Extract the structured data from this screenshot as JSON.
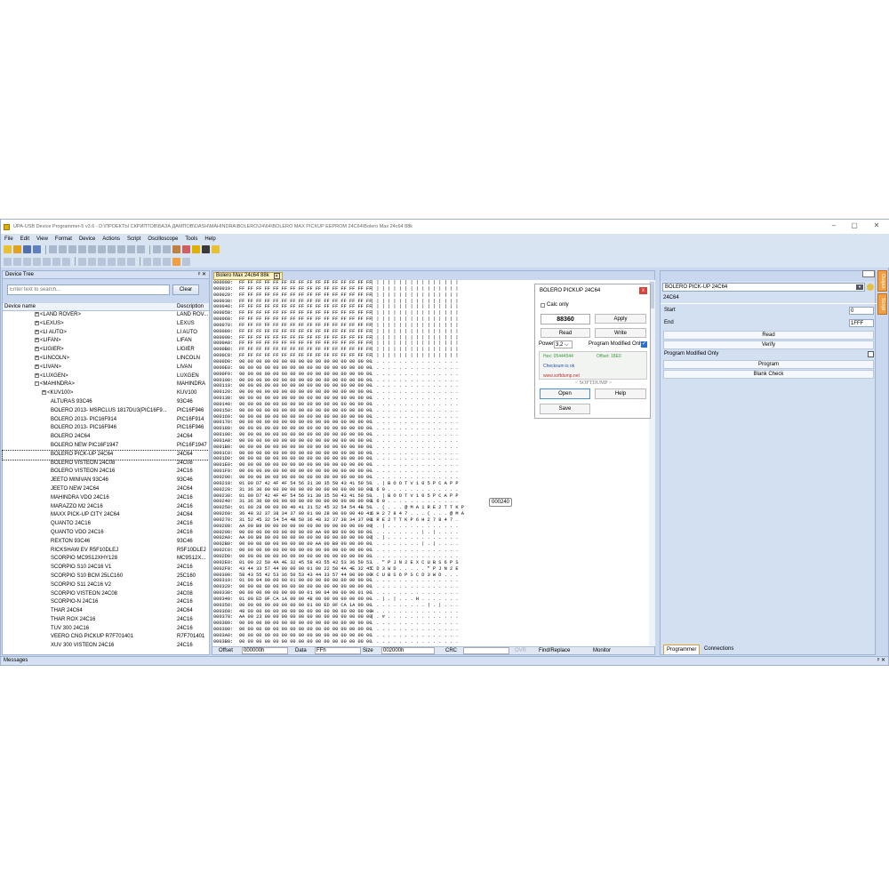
{
  "window": {
    "title": "UPA-USB Device Programmer-5 v3.6 - D:\\ПРОЕКТЫ СКРИПТОВ\\БАЗА ДАМПОВ\\DASH\\MAHINDRA\\BOLERO\\24\\64\\BOLERO MAX PICKUP EEPROM 24C64\\Bolero Max 24c64 88k",
    "minimize": "–",
    "maximize": "▢",
    "close": "✕"
  },
  "menu": [
    "File",
    "Edit",
    "View",
    "Format",
    "Device",
    "Actions",
    "Script",
    "Oscilloscope",
    "Tools",
    "Help"
  ],
  "device_tree": {
    "title": "Device Tree",
    "pin": "ᵖ ✕",
    "search_placeholder": "Enter text to search...",
    "clear": "Clear",
    "col_name": "Device name",
    "col_desc": "Description",
    "rows": [
      {
        "name": "<LAND ROVER>",
        "desc": "LAND ROV...",
        "lvl": 1,
        "exp": "+"
      },
      {
        "name": "<LEXUS>",
        "desc": "LEXUS",
        "lvl": 1,
        "exp": "+"
      },
      {
        "name": "<LI AUTO>",
        "desc": "LI AUTO",
        "lvl": 1,
        "exp": "+"
      },
      {
        "name": "<LIFAN>",
        "desc": "LIFAN",
        "lvl": 1,
        "exp": "+"
      },
      {
        "name": "<LIGIER>",
        "desc": "LIGIER",
        "lvl": 1,
        "exp": "+"
      },
      {
        "name": "<LINCOLN>",
        "desc": "LINCOLN",
        "lvl": 1,
        "exp": "+"
      },
      {
        "name": "<LIVAN>",
        "desc": "LIVAN",
        "lvl": 1,
        "exp": "+"
      },
      {
        "name": "<LUXGEN>",
        "desc": "LUXGEN",
        "lvl": 1,
        "exp": "+"
      },
      {
        "name": "<MAHINDRA>",
        "desc": "MAHINDRA",
        "lvl": 1,
        "exp": "-"
      },
      {
        "name": "<KUV100>",
        "desc": "KUV100",
        "lvl": 2,
        "exp": "+"
      },
      {
        "name": "ALTURAS 93C46",
        "desc": "93C46",
        "lvl": 3
      },
      {
        "name": "BOLERO 2013- MSRCLUS 1817DU3(PIC16F9...",
        "desc": "PIC16F946",
        "lvl": 3
      },
      {
        "name": "BOLERO 2013- PIC16F914",
        "desc": "PIC16F914",
        "lvl": 3
      },
      {
        "name": "BOLERO 2013- PIC16F946",
        "desc": "PIC16F946",
        "lvl": 3
      },
      {
        "name": "BOLERO 24C64",
        "desc": "24C64",
        "lvl": 3
      },
      {
        "name": "BOLERO NEW PIC16F1947",
        "desc": "PIC16F1947",
        "lvl": 3
      },
      {
        "name": "BOLERO PICK-UP 24C64",
        "desc": "24C64",
        "lvl": 3,
        "sel": true
      },
      {
        "name": "BOLERO VISTEON 24C08",
        "desc": "24C08",
        "lvl": 3
      },
      {
        "name": "BOLERO VISTEON 24C16",
        "desc": "24C16",
        "lvl": 3
      },
      {
        "name": "JEETO MINIVAN 93C46",
        "desc": "93C46",
        "lvl": 3
      },
      {
        "name": "JEETO NEW 24C64",
        "desc": "24C64",
        "lvl": 3
      },
      {
        "name": "MAHINDRA VDO 24C16",
        "desc": "24C16",
        "lvl": 3
      },
      {
        "name": "MARAZZO M2 24C16",
        "desc": "24C16",
        "lvl": 3
      },
      {
        "name": "MAXX PICK-UP CITY 24C64",
        "desc": "24C64",
        "lvl": 3
      },
      {
        "name": "QUANTO 24C16",
        "desc": "24C16",
        "lvl": 3
      },
      {
        "name": "QUANTO VDO 24C16",
        "desc": "24C16",
        "lvl": 3
      },
      {
        "name": "REXTON 93C46",
        "desc": "93C46",
        "lvl": 3
      },
      {
        "name": "RICKSHAW EV R5F10DLEJ",
        "desc": "R5F10DLEJ",
        "lvl": 3
      },
      {
        "name": "SCORPIO MC9S12XHY128",
        "desc": "MC9S12X...",
        "lvl": 3
      },
      {
        "name": "SCORPIO S10 24C16 V1",
        "desc": "24C16",
        "lvl": 3
      },
      {
        "name": "SCORPIO S10 BCM 25LC160",
        "desc": "25C160",
        "lvl": 3
      },
      {
        "name": "SCORPIO S11 24C16 V2",
        "desc": "24C16",
        "lvl": 3
      },
      {
        "name": "SCORPIO VISTEON 24C08",
        "desc": "24C08",
        "lvl": 3
      },
      {
        "name": "SCORPIO-N 24C16",
        "desc": "24C16",
        "lvl": 3
      },
      {
        "name": "THAR 24C64",
        "desc": "24C64",
        "lvl": 3
      },
      {
        "name": "THAR ROX 24C16",
        "desc": "24C16",
        "lvl": 3
      },
      {
        "name": "TUV 300 24C16",
        "desc": "24C16",
        "lvl": 3
      },
      {
        "name": "VEERO CNG PICKUP R7F701401",
        "desc": "R7F701401",
        "lvl": 3
      },
      {
        "name": "XUV 300 VISTEON 24C16",
        "desc": "24C16",
        "lvl": 3
      }
    ]
  },
  "editor": {
    "tab": "Bolero Max 24c64 88k",
    "tab_close": "✕",
    "rows": [
      {
        "a": "000000:",
        "h": "FF FF FF FF FF FF FF FF FF FF FF FF FF FF FF FF",
        "s": "| | | | | | | | | | | | | | | |"
      },
      {
        "a": "000010:",
        "h": "FF FF FF FF FF FF FF FF FF FF FF FF FF FF FF FF",
        "s": "| | | | | | | | | | | | | | | |"
      },
      {
        "a": "000020:",
        "h": "FF FF FF FF FF FF FF FF FF FF FF FF FF FF FF FF",
        "s": "| | | | | | | | | | | | | | | |"
      },
      {
        "a": "000030:",
        "h": "FF FF FF FF FF FF FF FF FF FF FF FF FF FF FF FF",
        "s": "| | | | | | | | | | | | | | | |"
      },
      {
        "a": "000040:",
        "h": "FF FF FF FF FF FF FF FF FF FF FF FF FF FF FF FF",
        "s": "| | | | | | | | | | | | | | | |"
      },
      {
        "a": "000050:",
        "h": "FF FF FF FF FF FF FF FF FF FF FF FF FF FF FF FF",
        "s": "| | | | | | | | | | | | | | | |"
      },
      {
        "a": "000060:",
        "h": "FF FF FF FF FF FF FF FF FF FF FF FF FF FF FF FF",
        "s": "| | | | | | | | | | | | | | | |"
      },
      {
        "a": "000070:",
        "h": "FF FF FF FF FF FF FF FF FF FF FF FF FF FF FF FF",
        "s": "| | | | | | | | | | | | | | | |"
      },
      {
        "a": "000080:",
        "h": "FF FF FF FF FF FF FF FF FF FF FF FF FF FF FF FF",
        "s": "| | | | | | | | | | | | | | | |"
      },
      {
        "a": "000090:",
        "h": "FF FF FF FF FF FF FF FF FF FF FF FF FF FF FF FF",
        "s": "| | | | | | | | | | | | | | | |"
      },
      {
        "a": "0000A0:",
        "h": "FF FF FF FF FF FF FF FF FF FF FF FF FF FF FF FF",
        "s": "| | | | | | | | | | | | | | | |"
      },
      {
        "a": "0000B0:",
        "h": "FF FF FF FF FF FF FF FF FF FF FF FF FF FF FF FF",
        "s": "| | | | | | | | | | | | | | | |"
      },
      {
        "a": "0000C0:",
        "h": "FF FF FF FF FF FF FF FF FF FF FF FF FF FF FF FF",
        "s": "| | | | | | | | | | | | | | | |"
      },
      {
        "a": "0000D0:",
        "h": "00 00 00 00 00 00 00 00 00 00 00 00 00 00 00 00",
        "s": ". . . . . . . . . . . . . . . ."
      },
      {
        "a": "0000E0:",
        "h": "00 00 00 00 00 00 00 00 00 00 00 00 00 00 00 00",
        "s": ". . . . . . . . . . . . . . . ."
      },
      {
        "a": "0000F0:",
        "h": "00 00 00 00 00 00 00 00 00 00 00 00 00 00 00 00",
        "s": ". . . . . . . . . . . . . . . ."
      },
      {
        "a": "000100:",
        "h": "00 00 00 00 00 00 00 00 00 00 00 00 00 00 00 00",
        "s": ". . . . . . . . . . . . . . . ."
      },
      {
        "a": "000110:",
        "h": "00 00 00 00 00 00 00 00 00 00 00 00 00 00 00 00",
        "s": ". . . . . . . . . . . . . . . ."
      },
      {
        "a": "000120:",
        "h": "00 00 00 00 00 00 00 00 00 00 00 00 00 00 00 00",
        "s": ". . . . . . . . . . . . . . . ."
      },
      {
        "a": "000130:",
        "h": "00 00 00 00 00 00 00 00 00 00 00 00 00 00 00 00",
        "s": ". . . . . . . . . . . . . . . ."
      },
      {
        "a": "000140:",
        "h": "00 00 00 00 00 00 00 00 00 00 00 00 00 00 00 00",
        "s": ". . . . . . . . . . . . . . . ."
      },
      {
        "a": "000150:",
        "h": "00 00 00 00 00 00 00 00 00 00 00 00 00 00 00 00",
        "s": ". . . . . . . . . . . . . . . ."
      },
      {
        "a": "000160:",
        "h": "00 00 00 00 00 00 00 00 00 00 00 00 00 00 00 00",
        "s": ". . . . . . . . . . . . . . . ."
      },
      {
        "a": "000170:",
        "h": "00 00 00 00 00 00 00 00 00 00 00 00 00 00 00 00",
        "s": ". . . . . . . . . . . . . . . ."
      },
      {
        "a": "000180:",
        "h": "00 00 00 00 00 00 00 00 00 00 00 00 00 00 00 00",
        "s": ". . . . . . . . . . . . . . . ."
      },
      {
        "a": "000190:",
        "h": "00 00 00 00 00 00 00 00 00 00 00 00 00 00 00 00",
        "s": ". . . . . . . . . . . . . . . ."
      },
      {
        "a": "0001A0:",
        "h": "00 00 00 00 00 00 00 00 00 00 00 00 00 00 00 00",
        "s": ". . . . . . . . . . . . . . . ."
      },
      {
        "a": "0001B0:",
        "h": "00 00 00 00 00 00 00 00 00 00 00 00 00 00 00 00",
        "s": ". . . . . . . . . . . . . . . ."
      },
      {
        "a": "0001C0:",
        "h": "00 00 00 00 00 00 00 00 00 00 00 00 00 00 00 00",
        "s": ". . . . . . . . . . . . . . . ."
      },
      {
        "a": "0001D0:",
        "h": "00 00 00 00 00 00 00 00 00 00 00 00 00 00 00 00",
        "s": ". . . . . . . . . . . . . . . ."
      },
      {
        "a": "0001E0:",
        "h": "00 00 00 00 00 00 00 00 00 00 00 00 00 00 00 00",
        "s": ". . . . . . . . . . . . . . . ."
      },
      {
        "a": "0001F0:",
        "h": "00 00 00 00 00 00 00 00 00 00 00 00 00 00 00 00",
        "s": ". . . . . . . . . . . . . . . ."
      },
      {
        "a": "000200:",
        "h": "00 00 00 00 00 00 00 00 00 00 00 00 00 00 00 00",
        "s": ". . . . . . . . . . . . . . . ."
      },
      {
        "a": "000210:",
        "h": "01 00 D7 42 4F 4F 54 56 31 30 35 50 43 41 50 50",
        "s": ". . | B O O T V 1 0 5 P C A P P"
      },
      {
        "a": "000220:",
        "h": "31 36 30 00 00 00 00 00 00 00 00 00 00 00 00 00",
        "s": "1 6 0 . . . . . . . . . . . . ."
      },
      {
        "a": "000230:",
        "h": "01 00 D7 42 4F 4F 54 56 31 30 35 50 43 41 50 50",
        "s": ". . | B O O T V 1 0 5 P C A P P"
      },
      {
        "a": "000240:",
        "h": "31 36 30 00 00 00 00 00 00 00 00 00 00 00 00 00",
        "s": "1 6 0 . . . . . . . . . . . . ."
      },
      {
        "a": "000250:",
        "h": "01 00 28 00 00 00 40 41 31 52 45 32 54 54 4B 50",
        "s": ". . ( . . . @ M A 1 R E 2 T T K P"
      },
      {
        "a": "000260:",
        "h": "36 48 32 37 38 34 37 00 01 00 28 00 00 00 40 41",
        "s": "6 H 2 7 8 4 7 . . . ( . . . @ M A"
      },
      {
        "a": "000270:",
        "h": "31 52 45 32 54 54 4B 50 36 48 32 37 38 34 37 00",
        "s": "1 R E 2 T T K P 6 H 2 7 8 4 7 ."
      },
      {
        "a": "000280:",
        "h": "AA 00 B9 00 00 00 00 00 00 00 00 00 00 00 00 00",
        "s": "| . | . . . . . . . . . . . . ."
      },
      {
        "a": "000290:",
        "h": "00 00 00 00 00 00 00 00 00 AA 00 B9 00 00 00 00",
        "s": ". . . . . . . . . | . | . . . ."
      },
      {
        "a": "0002A0:",
        "h": "AA 00 B9 00 00 00 00 00 00 00 00 00 00 00 00 00",
        "s": "| . | . . . . . . . . . . . . ."
      },
      {
        "a": "0002B0:",
        "h": "00 00 00 00 00 00 00 00 00 AA 00 B9 00 00 00 00",
        "s": ". . . . . . . . . | . | . . . ."
      },
      {
        "a": "0002C0:",
        "h": "00 00 00 00 00 00 00 00 00 00 00 00 00 00 00 00",
        "s": ". . . . . . . . . . . . . . . ."
      },
      {
        "a": "0002D0:",
        "h": "00 00 00 00 00 00 00 00 00 00 00 00 00 00 00 00",
        "s": ". . . . . . . . . . . . . . . ."
      },
      {
        "a": "0002E0:",
        "h": "01 00 22 50 4A 4E 32 45 58 43 55 42 53 36 50 53",
        "s": ". . \" P J N 2 E X C U B S 6 P S"
      },
      {
        "a": "0002F0:",
        "h": "43 44 33 57 44 00 00 00 01 00 22 50 4A 4E 32 45",
        "s": "C D 3 W D . . . . . \" P J N 2 E"
      },
      {
        "a": "000300:",
        "h": "58 43 55 42 53 36 50 53 43 44 33 57 44 00 00 00",
        "s": "X C U B S 6 P S C D 3 W D . . ."
      },
      {
        "a": "000310:",
        "h": "01 00 04 00 00 00 01 00 00 00 00 00 00 00 00 00",
        "s": ". . . . . . . . . . . . . . . ."
      },
      {
        "a": "000320:",
        "h": "00 00 00 00 00 00 00 00 00 00 00 00 00 00 00 00",
        "s": ". . . . . . . . . . . . . . . ."
      },
      {
        "a": "000330:",
        "h": "00 00 00 00 00 00 00 00 01 00 04 00 00 00 01 00",
        "s": ". . . . . . . . . . . . . . . ."
      },
      {
        "a": "000340:",
        "h": "01 00 ED 0F CA 1A 00 00 48 00 00 00 00 00 00 00",
        "s": ". . | . | . . . H . . . . . . ."
      },
      {
        "a": "000350:",
        "h": "00 00 00 00 00 00 00 00 01 00 ED 0F CA 1A 00 00",
        "s": ". . . . . . . . . . | . | . . ."
      },
      {
        "a": "000360:",
        "h": "48 00 00 00 00 00 00 00 00 00 00 00 00 00 00 00",
        "s": "H . . . . . . . . . . . . . . ."
      },
      {
        "a": "000370:",
        "h": "AA 00 23 00 00 00 00 00 00 00 00 00 00 00 00 00",
        "s": "| . # . . . . . . . . . . . . ."
      },
      {
        "a": "000380:",
        "h": "00 00 00 00 00 00 00 00 00 00 00 00 00 00 00 00",
        "s": ". . . . . . . . . . . . . . . ."
      },
      {
        "a": "000390:",
        "h": "00 00 00 00 00 00 00 00 00 00 00 00 00 00 00 00",
        "s": ". . . . . . . . . . . . . . . ."
      },
      {
        "a": "0003A0:",
        "h": "00 00 00 00 00 00 00 00 00 00 00 00 00 00 00 00",
        "s": ". . . . . . . . . . . . . . . ."
      },
      {
        "a": "0003B0:",
        "h": "00 00 00 00 00 00 00 00 00 00 00 00 00 00 00 00",
        "s": ". . . . . . . . . . . . . . . ."
      }
    ],
    "tooltip": "000240",
    "status": {
      "offset_label": "Offset",
      "offset_value": "000000h",
      "data_label": "Data",
      "data_value": "FFh",
      "size_label": "Size",
      "size_value": "002000h",
      "crc_label": "CRC",
      "ovr": "OVR",
      "find": "Find/Replace",
      "monitor": "Monitor"
    }
  },
  "dialog": {
    "title": "BOLERO PICKUP 24C64",
    "close": "x",
    "calc_only": "Calc only",
    "number": "88360",
    "apply": "Apply",
    "read": "Read",
    "write": "Write",
    "power_label": "Power",
    "power_value": "3,2",
    "prog_modified": "Program Modified Only",
    "hex": "Hex: 05444544",
    "offset": "Offset: 18E0",
    "checksum": "Checksum is ok",
    "url": "www.softdump.net",
    "brand": "< SOFTDUMP >",
    "open": "Open",
    "help": "Help",
    "save": "Save"
  },
  "right_panel": {
    "device": "BOLERO PICK-UP 24C64",
    "chip": "24C64",
    "start_label": "Start",
    "start_value": "0",
    "end_label": "End",
    "end_value": "1FFF",
    "read": "Read",
    "verify": "Verify",
    "prog_modified": "Program Modified Only",
    "program": "Program",
    "blank_check": "Blank Check",
    "tab_programmer": "Programmer",
    "tab_connections": "Connections",
    "side_tab1": "Output",
    "side_tab2": "Script"
  },
  "messages": {
    "title": "Messages",
    "pin": "ᵖ ✕"
  }
}
